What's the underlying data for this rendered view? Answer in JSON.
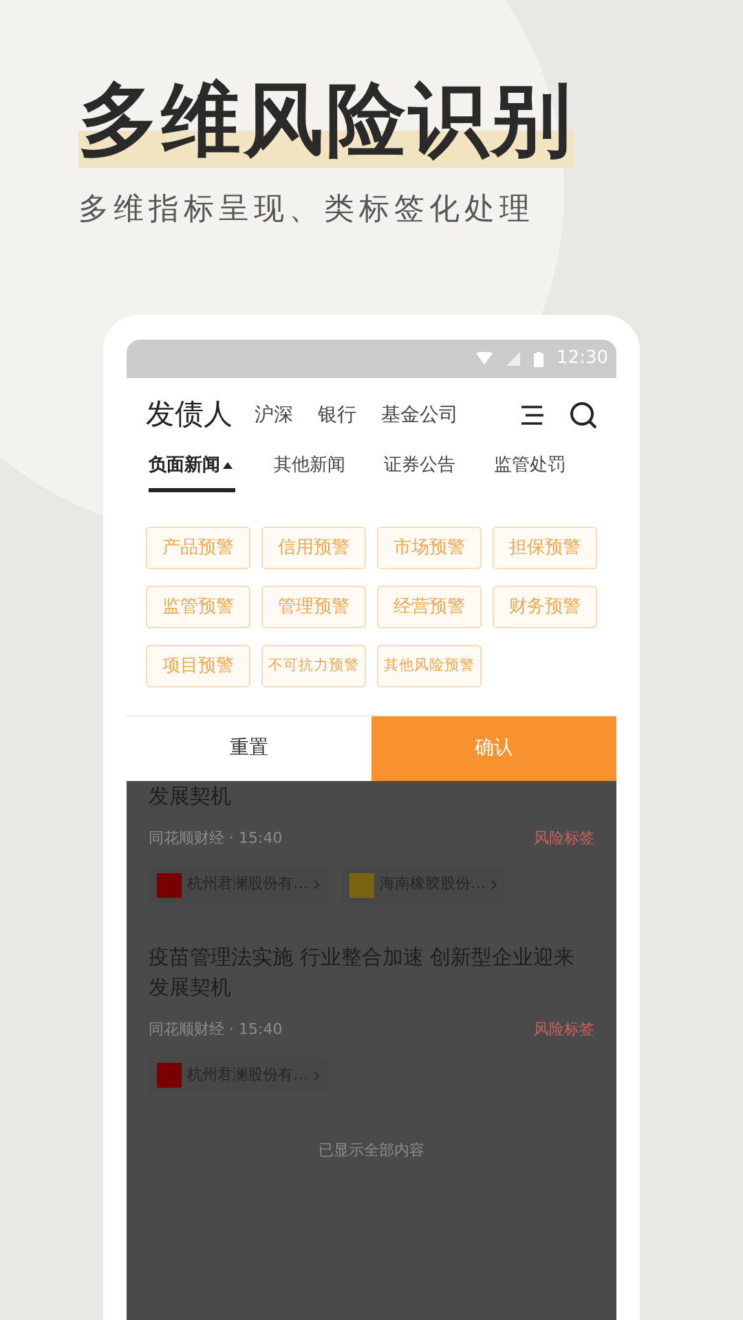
{
  "hero": {
    "title": "多维风险识别",
    "subtitle": "多维指标呈现、类标签化处理"
  },
  "status_bar": {
    "time": "12:30"
  },
  "header": {
    "title": "发债人",
    "channels": [
      {
        "label": "沪深"
      },
      {
        "label": "银行"
      },
      {
        "label": "基金公司"
      }
    ]
  },
  "tabs": [
    {
      "label": "负面新闻",
      "selected": true
    },
    {
      "label": "其他新闻",
      "selected": false
    },
    {
      "label": "证券公告",
      "selected": false
    },
    {
      "label": "监管处罚",
      "selected": false
    }
  ],
  "tags": [
    {
      "label": "产品预警"
    },
    {
      "label": "信用预警"
    },
    {
      "label": "市场预警"
    },
    {
      "label": "担保预警"
    },
    {
      "label": "监管预警"
    },
    {
      "label": "管理预警"
    },
    {
      "label": "经营预警"
    },
    {
      "label": "财务预警"
    },
    {
      "label": "项目预警"
    },
    {
      "label": "不可抗力预警"
    },
    {
      "label": "其他风险预警"
    }
  ],
  "buttons": {
    "reset": "重置",
    "confirm": "确认"
  },
  "news": [
    {
      "title": "发展契机",
      "source": "同花顺财经 · 15:40",
      "risk_label": "风险标签",
      "companies": [
        {
          "name": "杭州君澜股份有…",
          "color": "#7a0000"
        },
        {
          "name": "海南橡胶股份…",
          "color": "#7a6410"
        }
      ]
    },
    {
      "title": "疫苗管理法实施 行业整合加速 创新型企业迎来发展契机",
      "source": "同花顺财经 · 15:40",
      "risk_label": "风险标签",
      "companies": [
        {
          "name": "杭州君澜股份有…",
          "color": "#7a0000"
        }
      ]
    }
  ],
  "footer": "已显示全部内容"
}
